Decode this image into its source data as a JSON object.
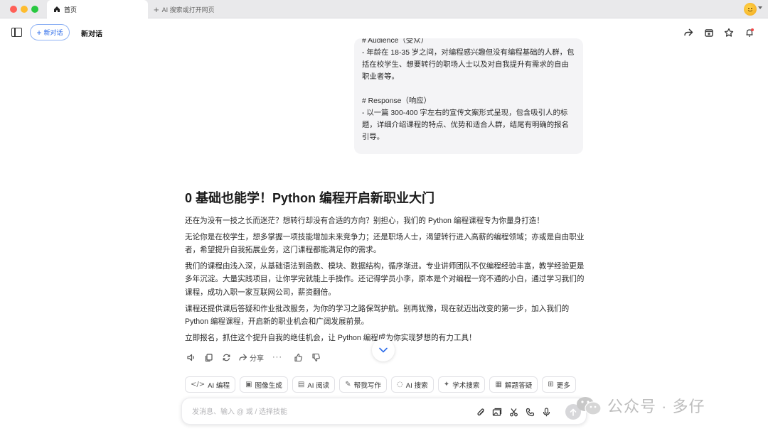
{
  "window": {
    "tabs": [
      {
        "label": "首页",
        "icon": "home-icon",
        "active": true
      },
      {
        "label": "AI 搜索或打开网页",
        "icon": "plus-icon",
        "active": false
      }
    ]
  },
  "toolbar": {
    "new_chat_label": "新对话",
    "page_title": "新对话",
    "icons": [
      "sidebar-icon",
      "share-icon",
      "save-icon",
      "star-icon",
      "bell-icon"
    ]
  },
  "user_message": {
    "lines": [
      "# Audience（受众）",
      "- 年龄在 18-35 岁之间，对编程感兴趣但没有编程基础的人群，包括在校学生、想要转行的职场人士以及对自我提升有需求的自由职业者等。",
      "",
      "# Response（响应）",
      "- 以一篇 300-400 字左右的宣传文案形式呈现，包含吸引人的标题，详细介绍课程的特点、优势和适合人群，结尾有明确的报名引导。"
    ]
  },
  "answer": {
    "title": "0 基础也能学！Python 编程开启新职业大门",
    "paragraphs": [
      "还在为没有一技之长而迷茫？想转行却没有合适的方向？别担心，我们的 Python 编程课程专为你量身打造！",
      "无论你是在校学生，想多掌握一项技能增加未来竞争力；还是职场人士，渴望转行进入高薪的编程领域；亦或是自由职业者，希望提升自我拓展业务，这门课程都能满足你的需求。",
      "我们的课程由浅入深，从基础语法到函数、模块、数据结构，循序渐进。专业讲师团队不仅编程经验丰富，教学经验更是多年沉淀。大量实践项目，让你学完就能上手操作。还记得学员小李，原本是个对编程一窍不通的小白，通过学习我们的课程，成功入职一家互联网公司，薪资翻倍。",
      "课程还提供课后答疑和作业批改服务，为你的学习之路保驾护航。别再犹豫，现在就迈出改变的第一步，加入我们的 Python 编程课程，开启新的职业机会和广阔发展前景。",
      "立即报名，抓住这个提升自我的绝佳机会，让 Python 编程成为你实现梦想的有力工具！"
    ]
  },
  "actions": {
    "share_label": "分享",
    "more_label": "···"
  },
  "skills": [
    {
      "label": "AI 编程",
      "icon": "code-icon",
      "glyph": "</>"
    },
    {
      "label": "图像生成",
      "icon": "image-icon",
      "glyph": "▣"
    },
    {
      "label": "AI 阅读",
      "icon": "reader-icon",
      "glyph": "▤"
    },
    {
      "label": "帮我写作",
      "icon": "pen-icon",
      "glyph": "✎"
    },
    {
      "label": "AI 搜索",
      "icon": "search-icon",
      "glyph": "◌"
    },
    {
      "label": "学术搜索",
      "icon": "academic-icon",
      "glyph": "✦"
    },
    {
      "label": "解题答疑",
      "icon": "calculator-icon",
      "glyph": "▦"
    },
    {
      "label": "更多",
      "icon": "grid-icon",
      "glyph": "⊞"
    }
  ],
  "composer": {
    "placeholder": "发消息、输入 @ 或 / 选择技能"
  },
  "watermark": {
    "text": "公众号 · 多仔"
  },
  "colors": {
    "accent": "#2a6ae9",
    "bubble": "#f4f4f6",
    "send_disabled": "#d7d7da"
  }
}
